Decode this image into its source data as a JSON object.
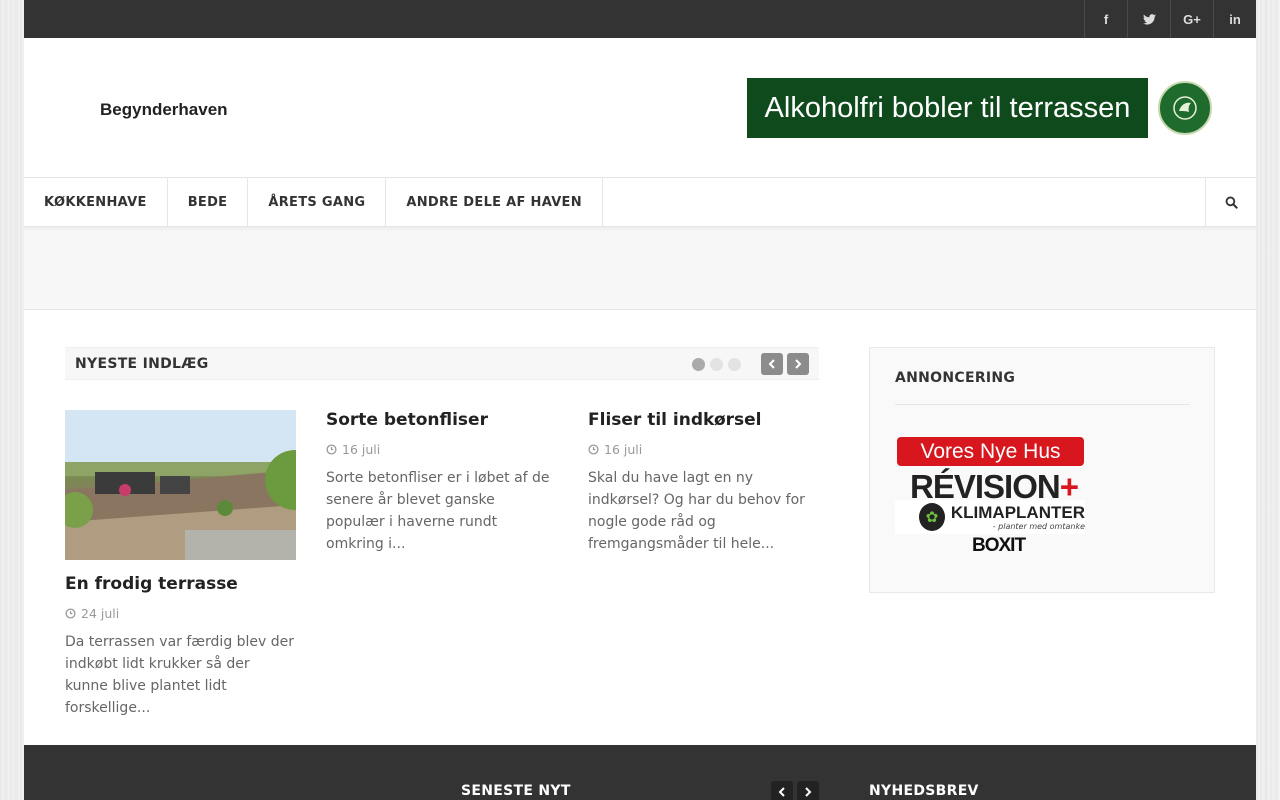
{
  "topbar": {
    "social": [
      {
        "name": "facebook",
        "glyph": "f"
      },
      {
        "name": "twitter",
        "glyph": "t"
      },
      {
        "name": "google-plus",
        "glyph": "G+"
      },
      {
        "name": "linkedin",
        "glyph": "in"
      }
    ]
  },
  "header": {
    "logo": "Begynderhaven",
    "banner_text": "Alkoholfri bobler til terrassen"
  },
  "nav": {
    "items": [
      "KØKKENHAVE",
      "BEDE",
      "ÅRETS GANG",
      "ANDRE DELE AF HAVEN"
    ]
  },
  "latest": {
    "title": "NYESTE INDLÆG",
    "posts": [
      {
        "title": "En frodig terrasse",
        "date": "24 juli",
        "excerpt": "Da terrassen var færdig blev der indkøbt lidt krukker så der kunne blive plantet lidt forskellige..."
      },
      {
        "title": "Sorte betonfliser",
        "date": "16 juli",
        "excerpt": "Sorte betonfliser er i løbet af de senere år blevet ganske populær i haverne rundt omkring i..."
      },
      {
        "title": "Fliser til indkørsel",
        "date": "16 juli",
        "excerpt": "Skal du have lagt en ny indkørsel? Og har du behov for nogle gode råd og fremgangsmåder til hele..."
      }
    ]
  },
  "sidebar": {
    "title": "ANNONCERING",
    "ads": {
      "ad1": "Vores Nye Hus",
      "ad2": "RÉVISION",
      "ad2_plus": "+",
      "ad3_title": "KLIMAPLANTER",
      "ad3_sub": "- planter med omtanke",
      "ad4": "BOXIT"
    }
  },
  "footer": {
    "news_title": "SENESTE NYT",
    "newsletter_title": "NYHEDSBREV"
  },
  "colors": {
    "topbar": "#333333",
    "banner": "#0f4a1c",
    "ad_red": "#d7161d"
  }
}
